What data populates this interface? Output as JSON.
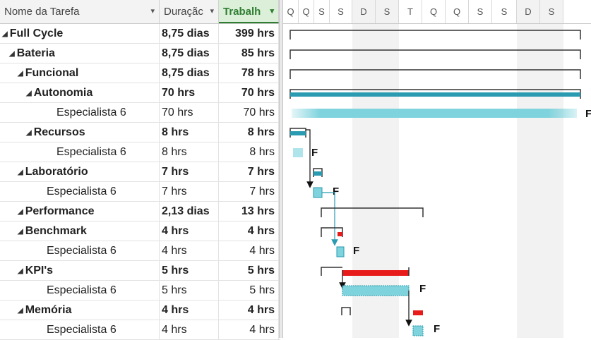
{
  "columns": {
    "name": "Nome da Tarefa",
    "duration": "Duraçãc",
    "work": "Trabalh",
    "sort_arrow": "▾"
  },
  "timeline_days": [
    "Q",
    "Q",
    "S",
    "S",
    "D",
    "S",
    "T",
    "Q",
    "Q",
    "S",
    "S",
    "D",
    "S"
  ],
  "rows": [
    {
      "name": "Full Cycle",
      "duration": "8,75 dias",
      "work": "399 hrs",
      "summary": true
    },
    {
      "name": "Bateria",
      "duration": "8,75 dias",
      "work": "85 hrs",
      "summary": true
    },
    {
      "name": "Funcional",
      "duration": "8,75 dias",
      "work": "78 hrs",
      "summary": true
    },
    {
      "name": "Autonomia",
      "duration": "70 hrs",
      "work": "70 hrs",
      "summary": true
    },
    {
      "name": "Especialista 6",
      "duration": "70 hrs",
      "work": "70 hrs",
      "summary": false
    },
    {
      "name": "Recursos",
      "duration": "8 hrs",
      "work": "8 hrs",
      "summary": true
    },
    {
      "name": "Especialista 6",
      "duration": "8 hrs",
      "work": "8 hrs",
      "summary": false
    },
    {
      "name": "Laboratório",
      "duration": "7 hrs",
      "work": "7 hrs",
      "summary": true
    },
    {
      "name": "Especialista 6",
      "duration": "7 hrs",
      "work": "7 hrs",
      "summary": false
    },
    {
      "name": "Performance",
      "duration": "2,13 dias",
      "work": "13 hrs",
      "summary": true
    },
    {
      "name": "Benchmark",
      "duration": "4 hrs",
      "work": "4 hrs",
      "summary": true
    },
    {
      "name": "Especialista 6",
      "duration": "4 hrs",
      "work": "4 hrs",
      "summary": false
    },
    {
      "name": "KPI's",
      "duration": "5 hrs",
      "work": "5 hrs",
      "summary": true
    },
    {
      "name": "Especialista 6",
      "duration": "5 hrs",
      "work": "5 hrs",
      "summary": false
    },
    {
      "name": "Memória",
      "duration": "4 hrs",
      "work": "4 hrs",
      "summary": true
    },
    {
      "name": "Especialista 6",
      "duration": "4 hrs",
      "work": "4 hrs",
      "summary": false
    }
  ],
  "bar_label": "F",
  "colors": {
    "teal": "#2a9bb0",
    "teal_light": "#7fd3dd",
    "critical": "#e81b1b",
    "header_highlight": "#2f7d32"
  }
}
